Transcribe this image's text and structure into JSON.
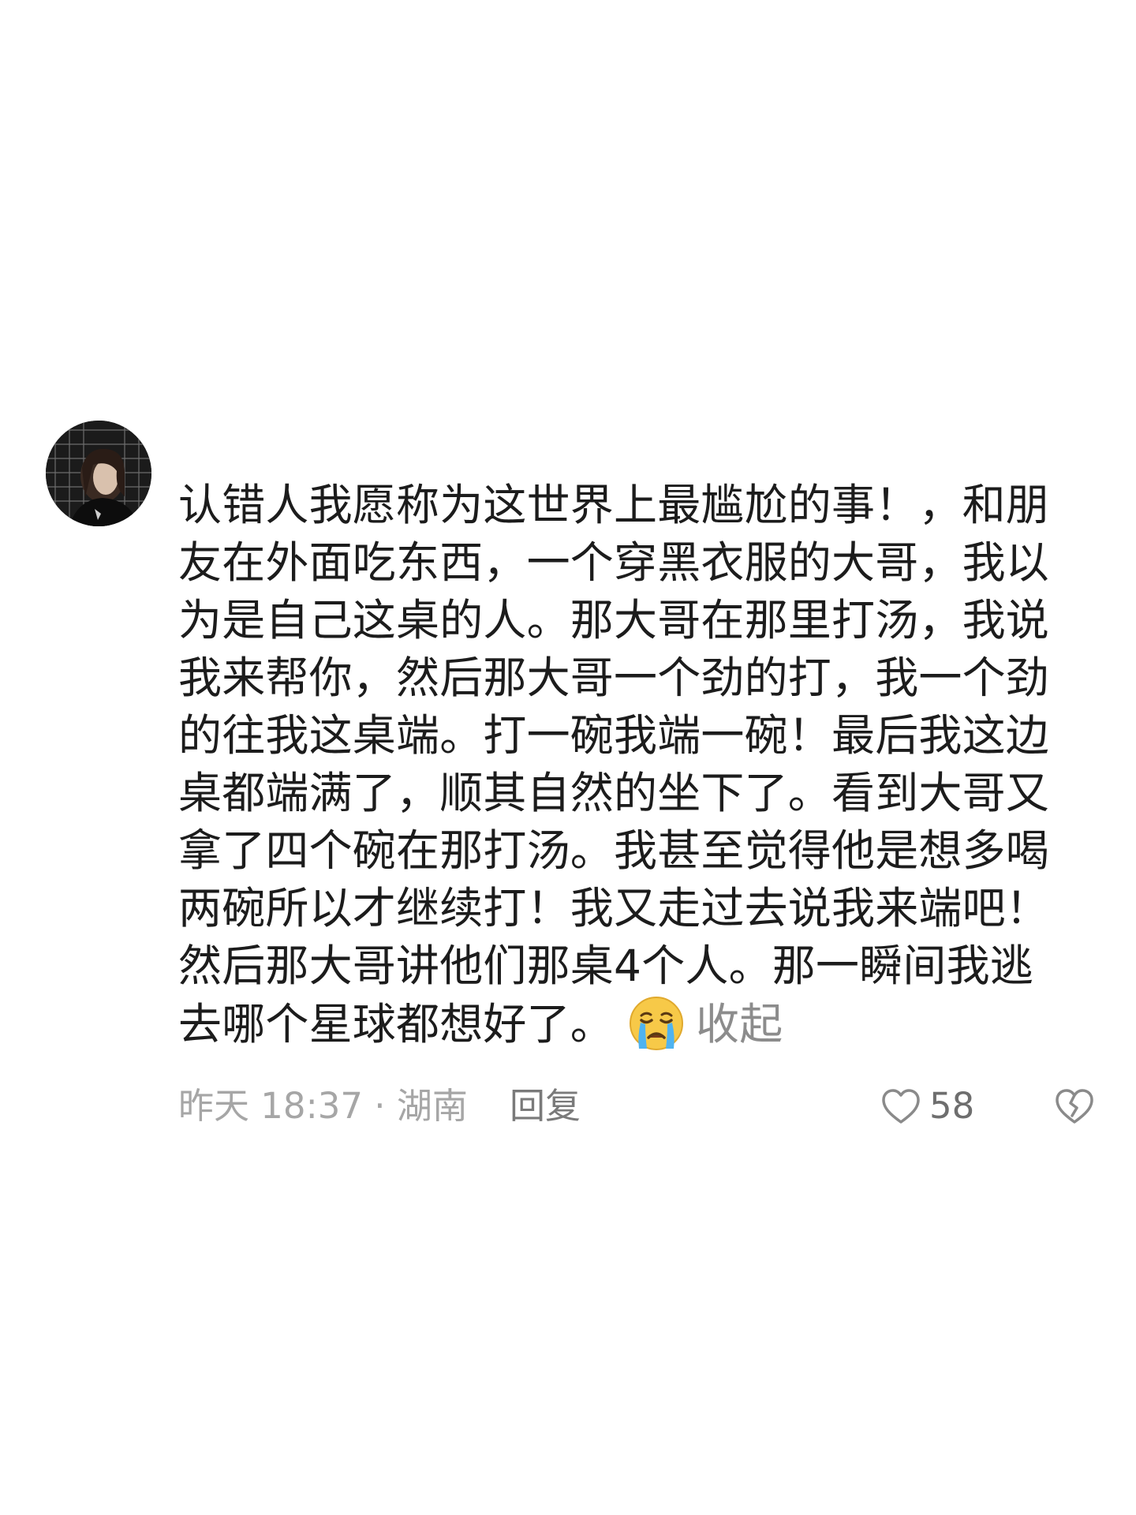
{
  "comment": {
    "avatar_icon": "user-avatar-photo",
    "text": "认错人我愿称为这世界上最尴尬的事！，和朋友在外面吃东西，一个穿黑衣服的大哥，我以为是自己这桌的人。那大哥在那里打汤，我说我来帮你，然后那大哥一个劲的打，我一个劲的往我这桌端。打一碗我端一碗！最后我这边桌都端满了，顺其自然的坐下了。看到大哥又拿了四个碗在那打汤。我甚至觉得他是想多喝两碗所以才继续打！我又走过去说我来端吧！然后那大哥讲他们那桌4个人。那一瞬间我逃去哪个星球都想好了。",
    "emoji": "crying-face-emoji",
    "collapse_label": "收起",
    "timestamp_location": "昨天 18:37 · 湖南",
    "reply_label": "回复",
    "like_count": "58",
    "like_icon": "heart-outline-icon",
    "dislike_icon": "broken-heart-icon"
  }
}
